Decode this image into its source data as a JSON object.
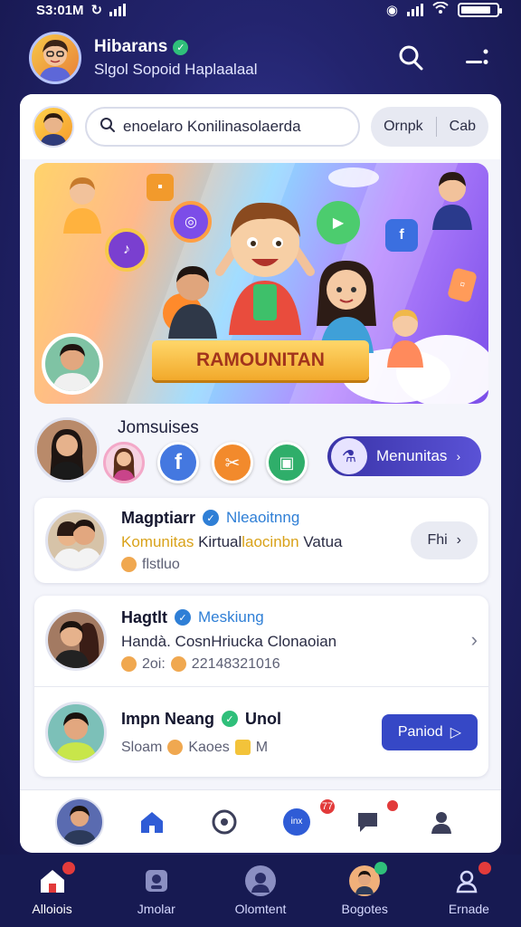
{
  "status": {
    "time": "S3:01M",
    "battery_level": 0.85
  },
  "header": {
    "title": "Hibarans",
    "subtitle": "Slgol Sopoid Haplaalaal",
    "icons": [
      "search-icon",
      "more-icon"
    ]
  },
  "search": {
    "placeholder": "enoelaro Konilinasolaerda",
    "segment_left": "Ornpk",
    "segment_right": "Cab"
  },
  "banner": {
    "ribbon_text": "RAMOUNITAN"
  },
  "stories": {
    "label": "Jomsuises",
    "action_label": "Menunitas",
    "items": [
      "avatar",
      "facebook-icon",
      "tools-icon",
      "chat-icon"
    ]
  },
  "feed": [
    {
      "name": "Magptiarr",
      "verified_color": "#2f7fd6",
      "meta": "Nleaoitnng",
      "line2_highlight": "Komunitas",
      "line2_mid": "Kirtual",
      "line2_highlight2": "laocinbn",
      "line2_end": "Vatua",
      "line3": "flstluo",
      "action": "Fhi"
    },
    {
      "name": "Hagtlt",
      "verified_color": "#2f7fd6",
      "meta": "Meskiung",
      "line2": "Handà. CosnHriucka Clonaoian",
      "line3_a": "2oi:",
      "line3_b": "22148321016"
    },
    {
      "name": "Impn Neang",
      "verified_color": "#2fbf7a",
      "meta": "Unol",
      "line3_a": "Sloam",
      "line3_b": "Kaoes",
      "line3_c": "M",
      "action": "Paniod"
    }
  ],
  "inner_tabs": {
    "items": [
      "avatar",
      "home-icon",
      "explore-icon",
      "notification-icon",
      "messages-icon",
      "profile-icon"
    ],
    "badge_notify": "77"
  },
  "bottom_nav": [
    {
      "label": "Alloiois",
      "icon": "home-icon",
      "active": true
    },
    {
      "label": "Jmolar",
      "icon": "market-icon",
      "active": false
    },
    {
      "label": "Olomtent",
      "icon": "community-icon",
      "active": false
    },
    {
      "label": "Bogotes",
      "icon": "friends-icon",
      "active": false
    },
    {
      "label": "Ernade",
      "icon": "account-icon",
      "active": false
    }
  ]
}
